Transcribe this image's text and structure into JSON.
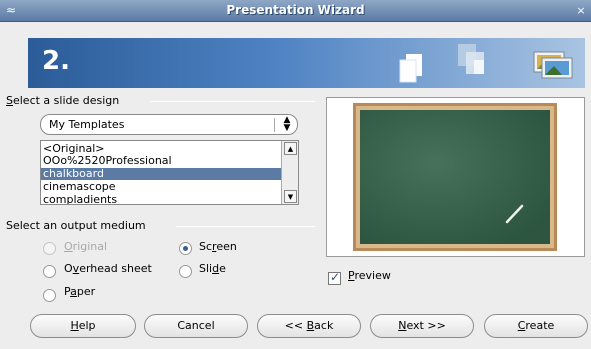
{
  "window": {
    "title": "Presentation Wizard",
    "icon": "app-icon",
    "close_icon": "close-icon",
    "close_glyph": "×"
  },
  "banner": {
    "step": "2.",
    "icons": [
      "blank-page-icon",
      "template-pages-icon",
      "picture-icon"
    ]
  },
  "slide_design": {
    "group_label_mnemonic": "S",
    "group_label_rest": "elect a slide design",
    "category": "My Templates",
    "templates": [
      "<Original>",
      "OOo%2520Professional",
      "chalkboard",
      "cinemascope",
      "compladients"
    ],
    "selected_template": "chalkboard"
  },
  "output_medium": {
    "group_label": "Select an output medium",
    "options": [
      {
        "key": "original",
        "pre": "",
        "mn": "O",
        "post": "riginal",
        "selected": false,
        "disabled": true
      },
      {
        "key": "screen",
        "pre": "Sc",
        "mn": "r",
        "post": "een",
        "selected": true,
        "disabled": false
      },
      {
        "key": "overhead",
        "pre": "O",
        "mn": "v",
        "post": "erhead sheet",
        "selected": false,
        "disabled": false
      },
      {
        "key": "slide",
        "pre": "Sli",
        "mn": "d",
        "post": "e",
        "selected": false,
        "disabled": false
      },
      {
        "key": "paper",
        "pre": "P",
        "mn": "a",
        "post": "per",
        "selected": false,
        "disabled": false
      }
    ]
  },
  "preview": {
    "checkbox_mn": "P",
    "checkbox_rest": "review",
    "checked": true,
    "thumbnail": "chalkboard-preview"
  },
  "buttons": {
    "help": {
      "pre": "",
      "mn": "H",
      "post": "elp"
    },
    "cancel": {
      "label": "Cancel"
    },
    "back": {
      "pre": "<< ",
      "mn": "B",
      "post": "ack"
    },
    "next": {
      "pre": "",
      "mn": "N",
      "post": "ext >>"
    },
    "create": {
      "pre": "",
      "mn": "C",
      "post": "reate"
    }
  },
  "colors": {
    "banner_start": "#2b5c98",
    "selection": "#5b7ba5",
    "chalkboard": "#34614a",
    "frame": "#b78a57"
  }
}
